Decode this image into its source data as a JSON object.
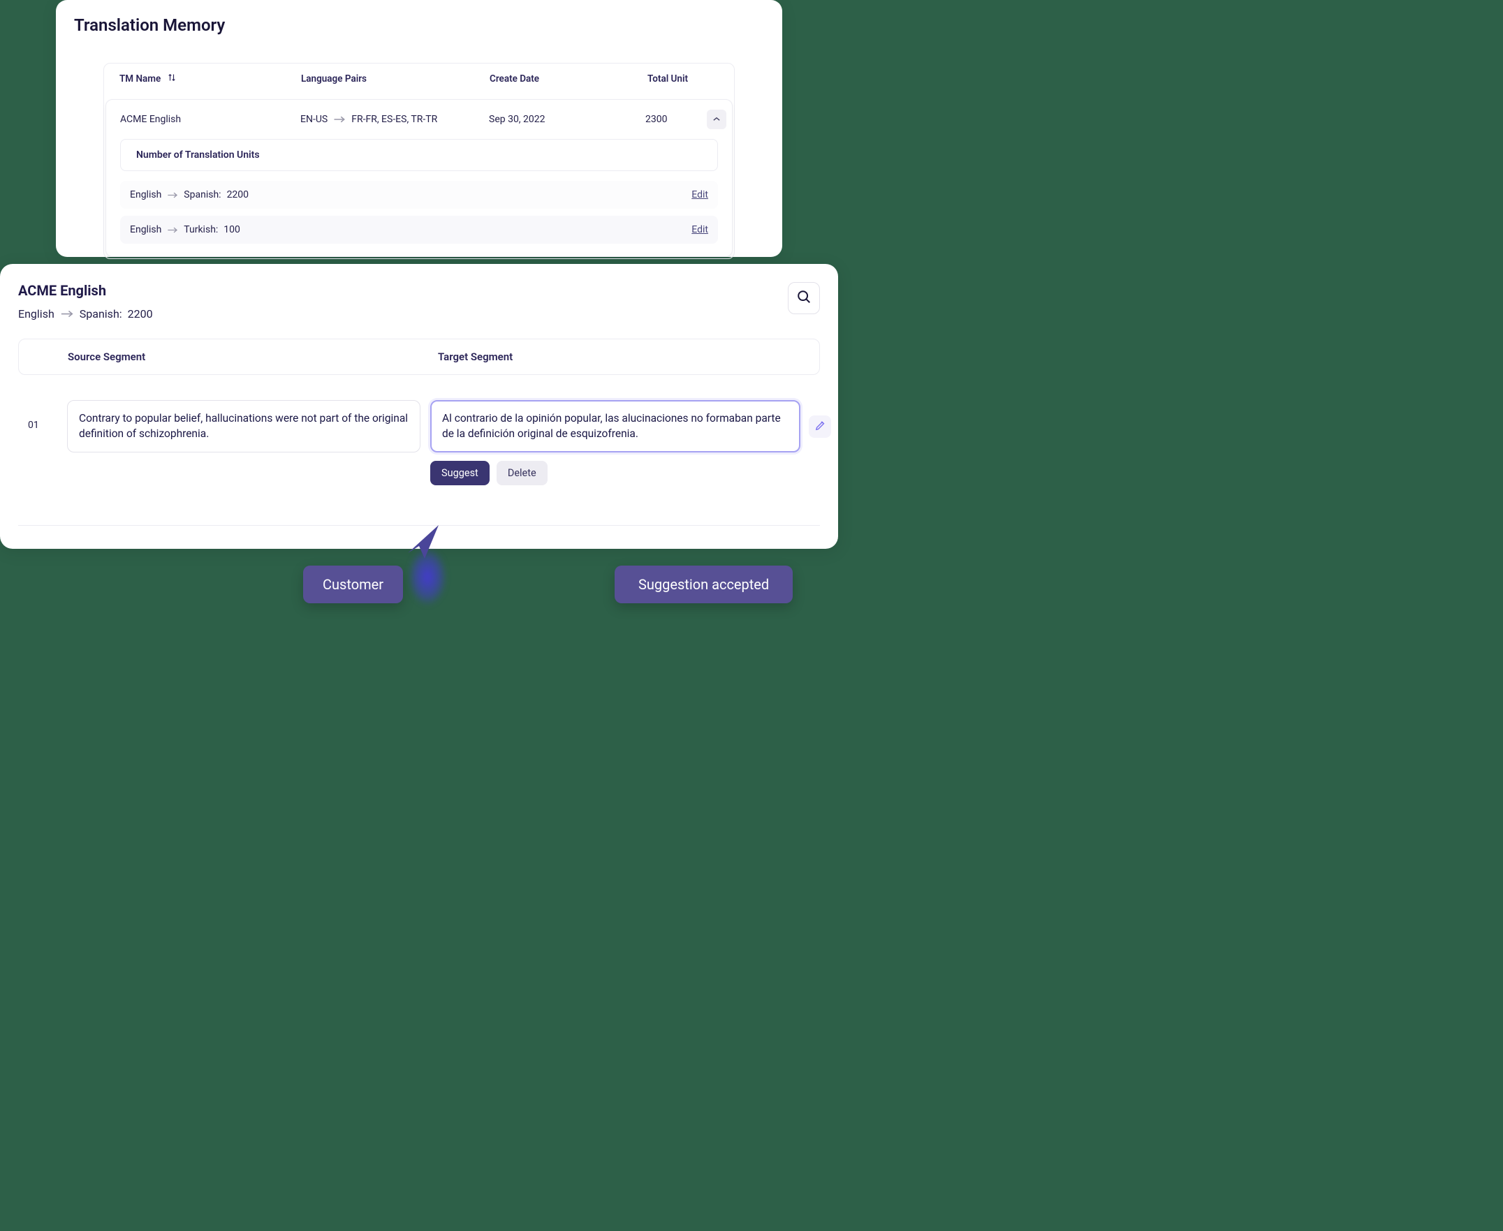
{
  "tm": {
    "title": "Translation Memory",
    "cols": {
      "name": "TM Name",
      "pairs": "Language Pairs",
      "date": "Create Date",
      "total": "Total Unit"
    },
    "row": {
      "name": "ACME English",
      "src": "EN-US",
      "targets": "FR-FR, ES-ES, TR-TR",
      "date": "Sep 30, 2022",
      "total": "2300"
    },
    "unitsLabel": "Number of Translation Units",
    "units": [
      {
        "src": "English",
        "tgt": "Spanish:",
        "val": "2200"
      },
      {
        "src": "English",
        "tgt": "Turkish:",
        "val": "100"
      }
    ],
    "edit": "Edit"
  },
  "editor": {
    "title": "ACME English",
    "src": "English",
    "tgt": "Spanish:",
    "count": "2200",
    "cols": {
      "src": "Source Segment",
      "tgt": "Target Segment"
    },
    "seg": {
      "idx": "01",
      "source": "Contrary to popular belief, hallucinations were not part of the original definition of schizophrenia.",
      "target": "Al contrario de la opinión popular, las alucinaciones no formaban parte de la definición original de esquizofrenia."
    },
    "suggest": "Suggest",
    "delete": "Delete"
  },
  "badges": {
    "customer": "Customer",
    "accepted": "Suggestion accepted"
  }
}
